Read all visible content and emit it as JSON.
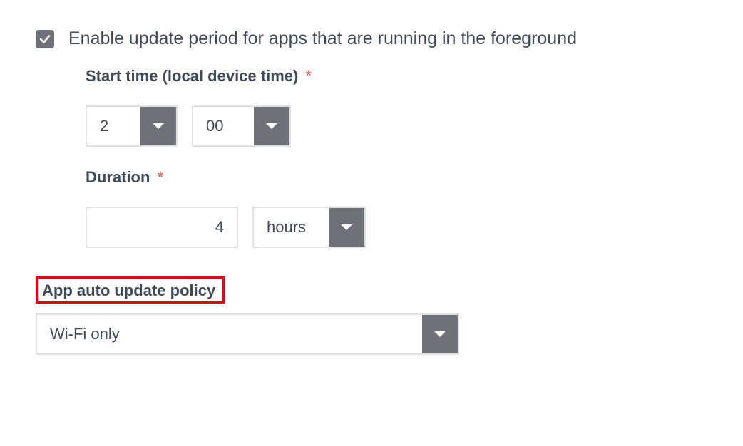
{
  "enable": {
    "checked": true,
    "label": "Enable update period for apps that are running in the foreground"
  },
  "startTime": {
    "label": "Start time (local device time)",
    "required": "*",
    "hour": "2",
    "minute": "00"
  },
  "duration": {
    "label": "Duration",
    "required": "*",
    "value": "4",
    "unit": "hours"
  },
  "policy": {
    "label": "App auto update policy",
    "value": "Wi-Fi only"
  }
}
